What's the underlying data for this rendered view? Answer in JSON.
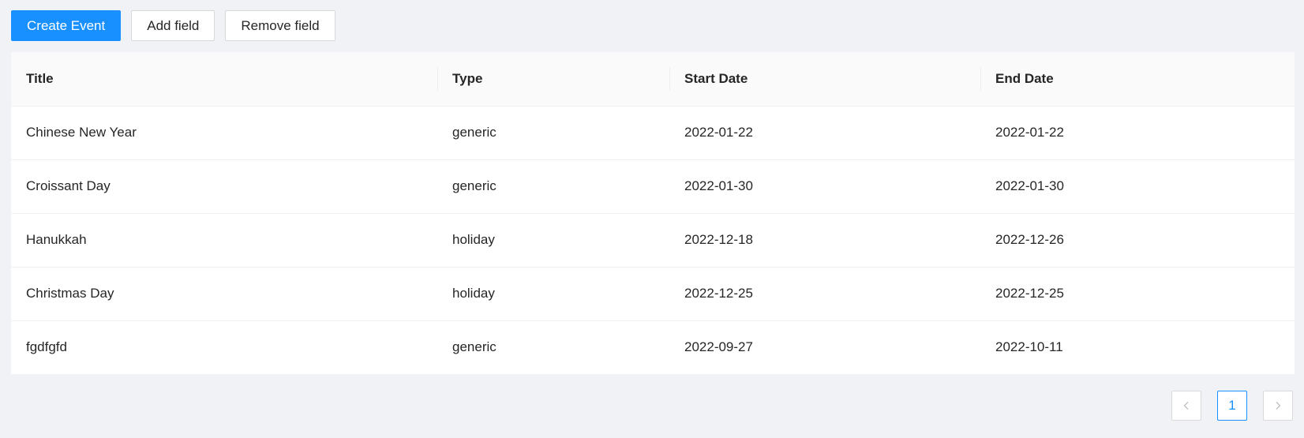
{
  "toolbar": {
    "create_label": "Create Event",
    "add_label": "Add field",
    "remove_label": "Remove field"
  },
  "table": {
    "columns": [
      "Title",
      "Type",
      "Start Date",
      "End Date"
    ],
    "rows": [
      [
        "Chinese New Year",
        "generic",
        "2022-01-22",
        "2022-01-22"
      ],
      [
        "Croissant Day",
        "generic",
        "2022-01-30",
        "2022-01-30"
      ],
      [
        "Hanukkah",
        "holiday",
        "2022-12-18",
        "2022-12-26"
      ],
      [
        "Christmas Day",
        "holiday",
        "2022-12-25",
        "2022-12-25"
      ],
      [
        "fgdfgfd",
        "generic",
        "2022-09-27",
        "2022-10-11"
      ]
    ]
  },
  "pagination": {
    "current_page": "1",
    "prev_icon": "chevron-left-icon",
    "next_icon": "chevron-right-icon"
  },
  "colors": {
    "primary": "#1890ff",
    "page_background": "#f0f2f5",
    "header_background": "#fafafa"
  }
}
